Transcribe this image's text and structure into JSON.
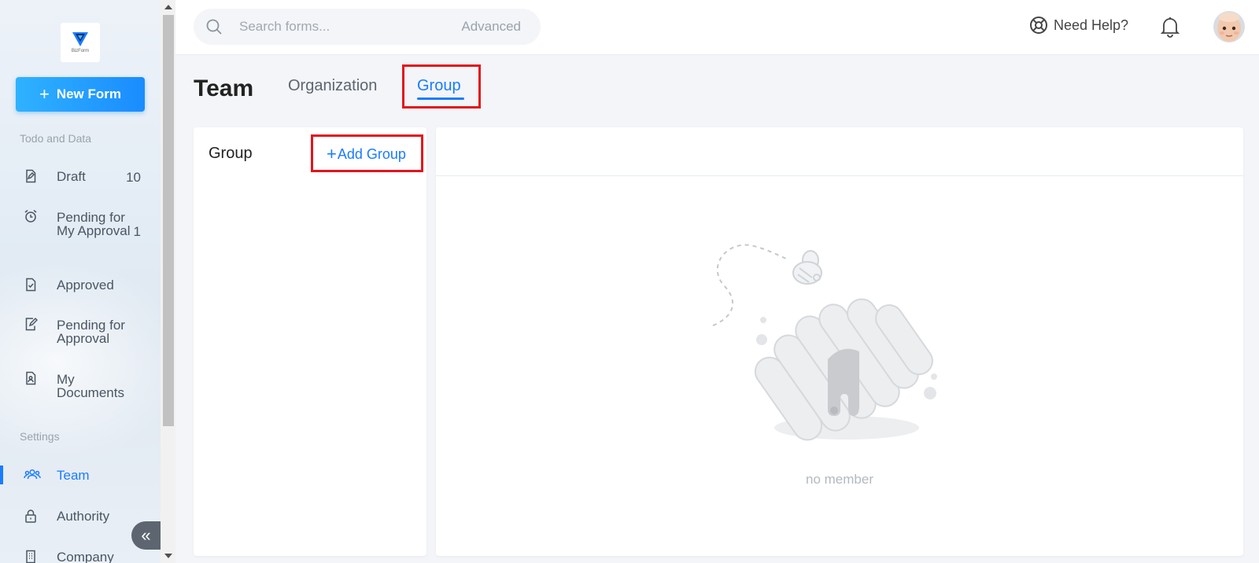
{
  "sidebar": {
    "logo_text": "BizForm",
    "new_form_label": "New Form",
    "sections": {
      "todo": "Todo and Data",
      "settings": "Settings"
    },
    "items": [
      {
        "label": "Draft",
        "count": "10",
        "icon": "draft-icon"
      },
      {
        "label": "Pending for My Approval",
        "count": "1",
        "icon": "alarm-clock-icon"
      },
      {
        "label": "Approved",
        "count": "",
        "icon": "approved-doc-icon"
      },
      {
        "label": "Pending for Approval",
        "count": "",
        "icon": "edit-doc-icon"
      },
      {
        "label": "My Documents",
        "count": "",
        "icon": "user-doc-icon"
      },
      {
        "label": "Team",
        "count": "",
        "icon": "team-icon",
        "active": true
      },
      {
        "label": "Authority",
        "count": "",
        "icon": "lock-icon"
      },
      {
        "label": "Company",
        "count": "",
        "icon": "building-icon"
      }
    ],
    "collapse_glyph": "«"
  },
  "header": {
    "search_placeholder": "Search forms...",
    "advanced_label": "Advanced",
    "help_label": "Need Help?"
  },
  "page": {
    "title": "Team",
    "tabs": [
      {
        "label": "Organization",
        "active": false
      },
      {
        "label": "Group",
        "active": true
      }
    ]
  },
  "group_panel": {
    "title": "Group",
    "add_label": "Add Group"
  },
  "members_panel": {
    "empty_text": "no member"
  },
  "colors": {
    "accent": "#1a7cff",
    "highlight": "#e3141d",
    "sidebar_bg": "#e6edf5"
  }
}
